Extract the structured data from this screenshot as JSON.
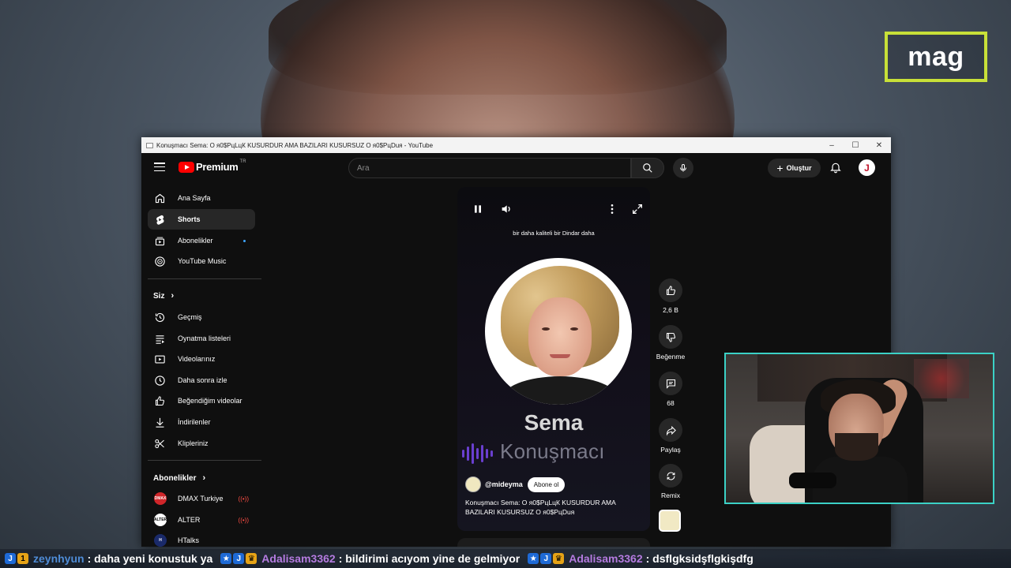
{
  "overlay": {
    "logo": "mag"
  },
  "window": {
    "title": "Konuşmacı Sema: O я0$РцLцК KUSURDUR AMA BAZILARI KUSURSUZ O я0$РцDuя - YouTube",
    "controls": [
      "–",
      "☐",
      "✕"
    ]
  },
  "header": {
    "brand": "Premium",
    "region": "TR",
    "search_placeholder": "Ara",
    "create_label": "Oluştur",
    "avatar_letter": "J"
  },
  "sidebar": {
    "main": [
      {
        "label": "Ana Sayfa",
        "icon": "home-icon"
      },
      {
        "label": "Shorts",
        "icon": "shorts-icon",
        "active": true
      },
      {
        "label": "Abonelikler",
        "icon": "subscriptions-icon",
        "dot": true
      },
      {
        "label": "YouTube Music",
        "icon": "music-icon"
      }
    ],
    "you_title": "Siz",
    "you": [
      {
        "label": "Geçmiş",
        "icon": "history-icon"
      },
      {
        "label": "Oynatma listeleri",
        "icon": "playlist-icon"
      },
      {
        "label": "Videolarınız",
        "icon": "your-videos-icon"
      },
      {
        "label": "Daha sonra izle",
        "icon": "watch-later-icon"
      },
      {
        "label": "Beğendiğim videolar",
        "icon": "liked-icon"
      },
      {
        "label": "İndirilenler",
        "icon": "download-icon"
      },
      {
        "label": "Klipleriniz",
        "icon": "clips-icon"
      }
    ],
    "subs_title": "Abonelikler",
    "subs": [
      {
        "label": "DMAX Turkiye",
        "avatar": "DMAX",
        "color": "#d0262a",
        "live": true
      },
      {
        "label": "ALTER",
        "avatar": "ALTER",
        "color": "#ffffff",
        "live": true
      },
      {
        "label": "HTalks",
        "avatar": "H",
        "color": "#1a2a6a",
        "live": false
      }
    ]
  },
  "short": {
    "top_text": "bir daha kaliteli bir Dindar daha",
    "speaker_name": "Sema",
    "speaker_role": "Konuşmacı",
    "channel": "@mideyma",
    "subscribe_label": "Abone ol",
    "title": "Konuşmacı Sema: O я0$РцLцК KUSURDUR AMA BAZILARI KUSURSUZ O я0$РцDuя"
  },
  "actions": {
    "like_count": "2,6 B",
    "dislike_label": "Beğenme",
    "comment_count": "68",
    "share_label": "Paylaş",
    "remix_label": "Remix"
  },
  "chat": [
    {
      "user": "zeynhyun",
      "color": "#4f8cd6",
      "message": ": daha yeni konustuk ya"
    },
    {
      "user": "Adalisam3362",
      "color": "#b57be0",
      "message": ": bildirimi acıyom yine de gelmiyor"
    },
    {
      "user": "Adalisam3362",
      "color": "#b57be0",
      "message": ": dsflgksidşflgkişdfg"
    }
  ]
}
